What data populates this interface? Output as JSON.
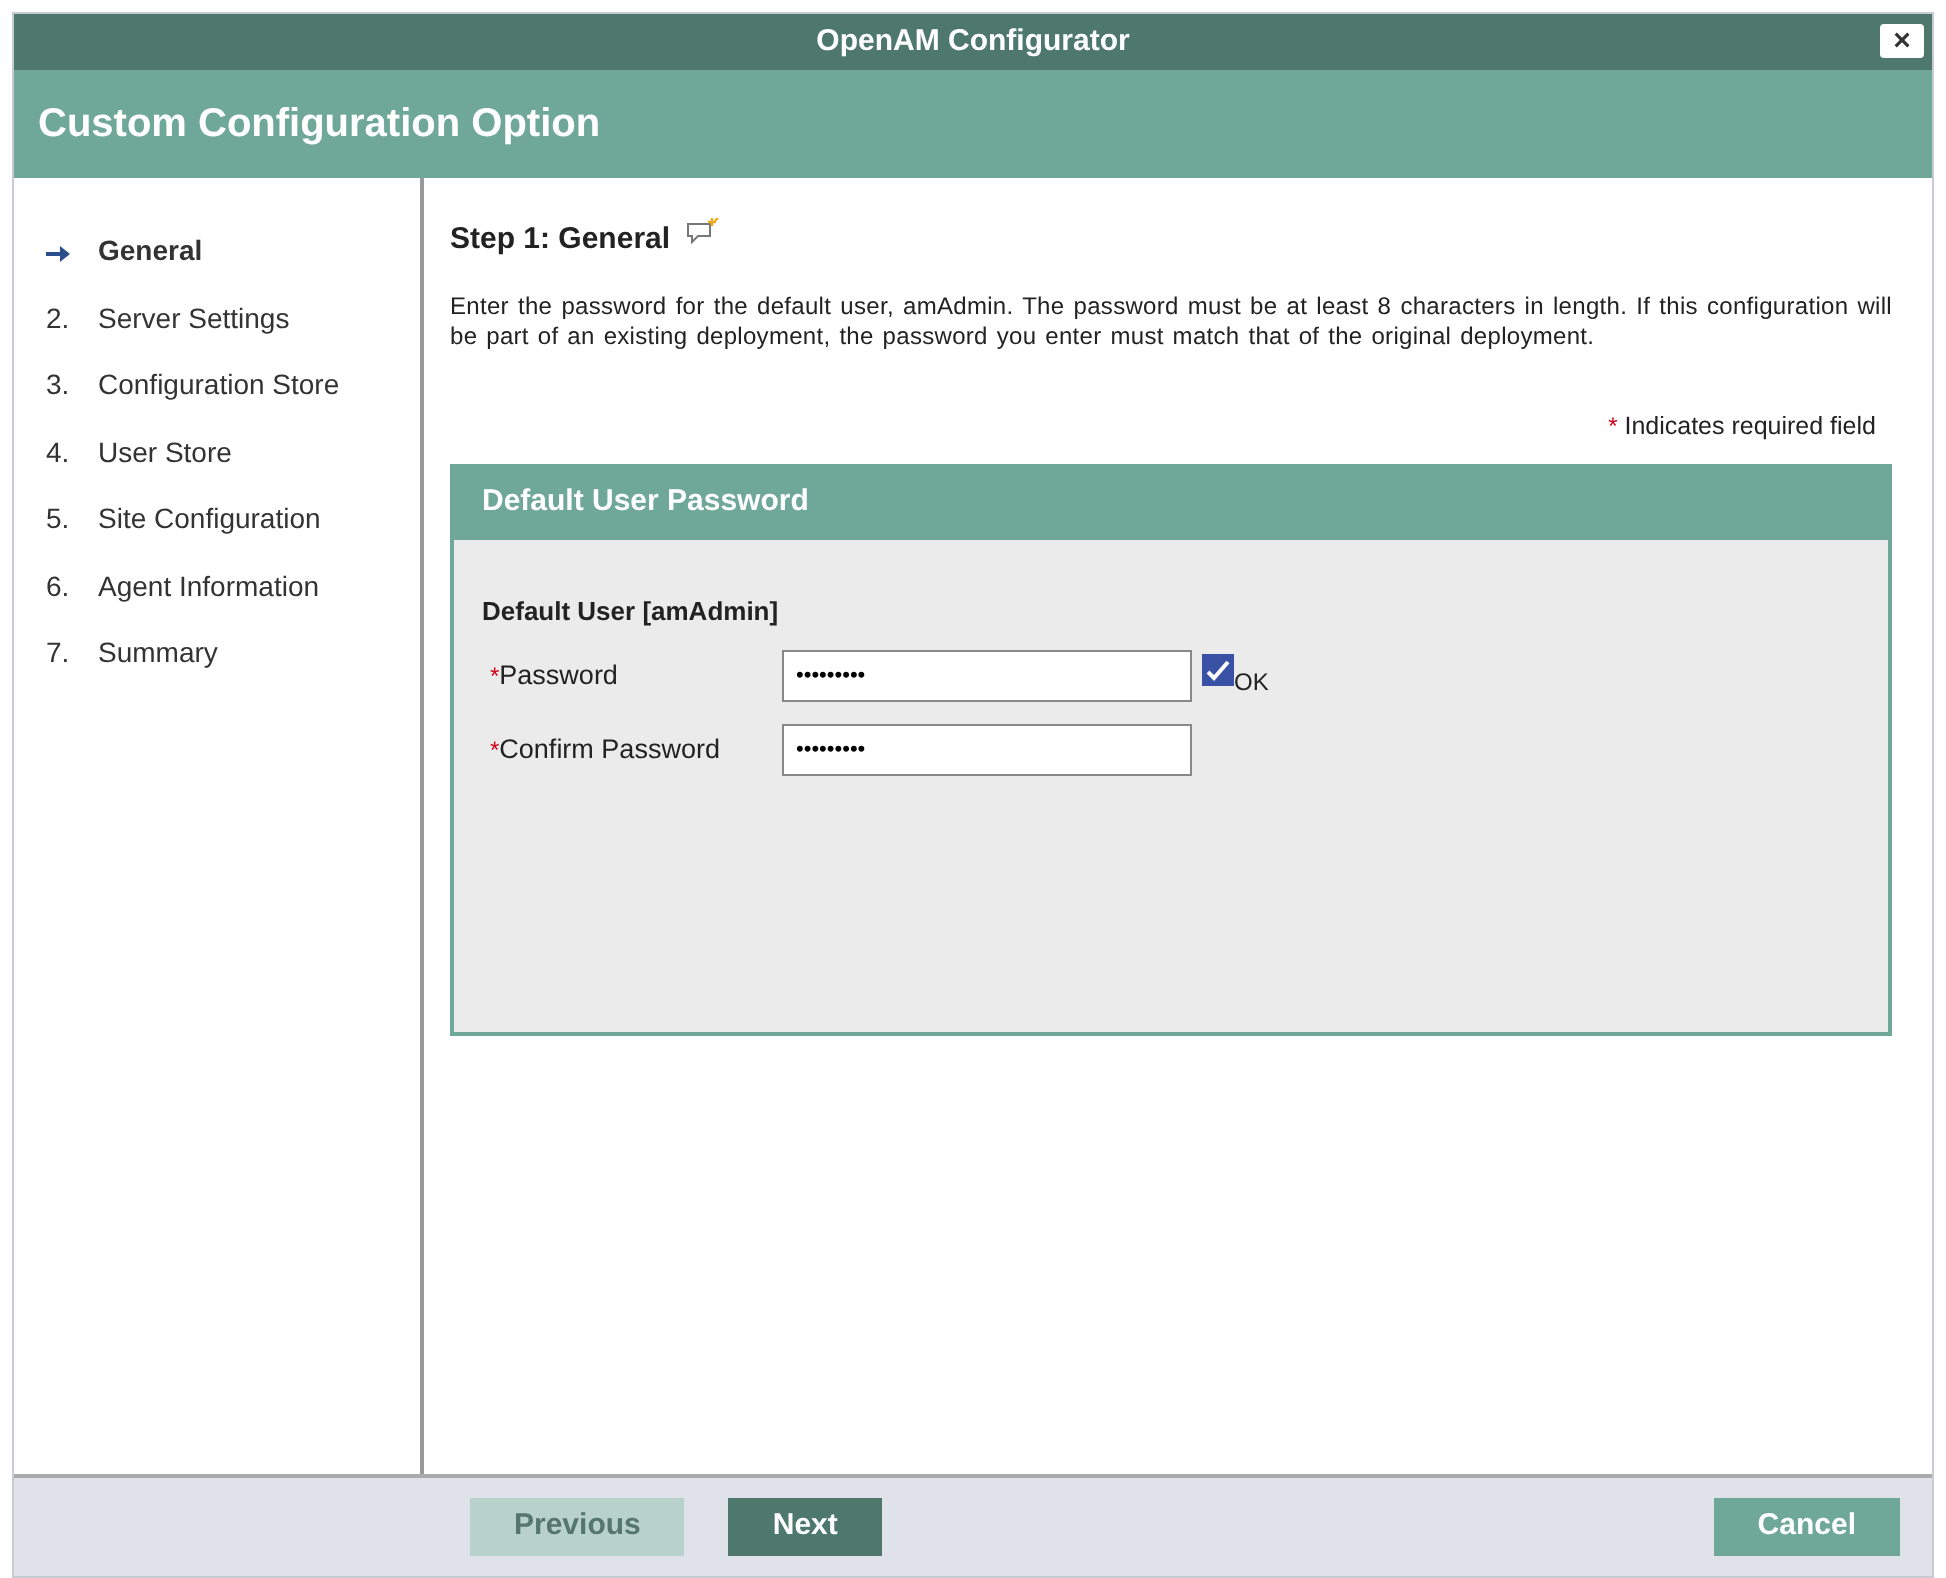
{
  "window": {
    "title": "OpenAM Configurator",
    "close": "×"
  },
  "header": {
    "title": "Custom Configuration Option"
  },
  "steps": [
    {
      "label": "General",
      "selected": true
    },
    {
      "number": "2.",
      "label": "Server Settings",
      "selected": false
    },
    {
      "number": "3.",
      "label": "Configuration Store",
      "selected": false
    },
    {
      "number": "4.",
      "label": "User Store",
      "selected": false
    },
    {
      "number": "5.",
      "label": "Site Configuration",
      "selected": false
    },
    {
      "number": "6.",
      "label": "Agent Information",
      "selected": false
    },
    {
      "number": "7.",
      "label": "Summary",
      "selected": false
    }
  ],
  "content": {
    "title": "Step 1: General",
    "description": "Enter the password for the default user, amAdmin. The password must be at least 8 characters in length. If this configuration will be part of an existing deployment, the password you enter must match that of the original deployment.",
    "required_mark": "*",
    "required_note": "Indicates required field"
  },
  "panel": {
    "title": "Default User Password",
    "subtitle": "Default User [amAdmin]",
    "fields": [
      {
        "label": "Password",
        "required": true,
        "value": "•••••••••",
        "status": {
          "checked": true,
          "text": "OK"
        }
      },
      {
        "label": "Confirm Password",
        "required": true,
        "value": "•••••••••"
      }
    ]
  },
  "buttons": [
    {
      "label": "Previous",
      "kind": "secondary",
      "disabled": true
    },
    {
      "label": "Next",
      "kind": "primary",
      "disabled": false
    },
    {
      "label": "Cancel",
      "kind": "cancel",
      "disabled": false
    }
  ]
}
